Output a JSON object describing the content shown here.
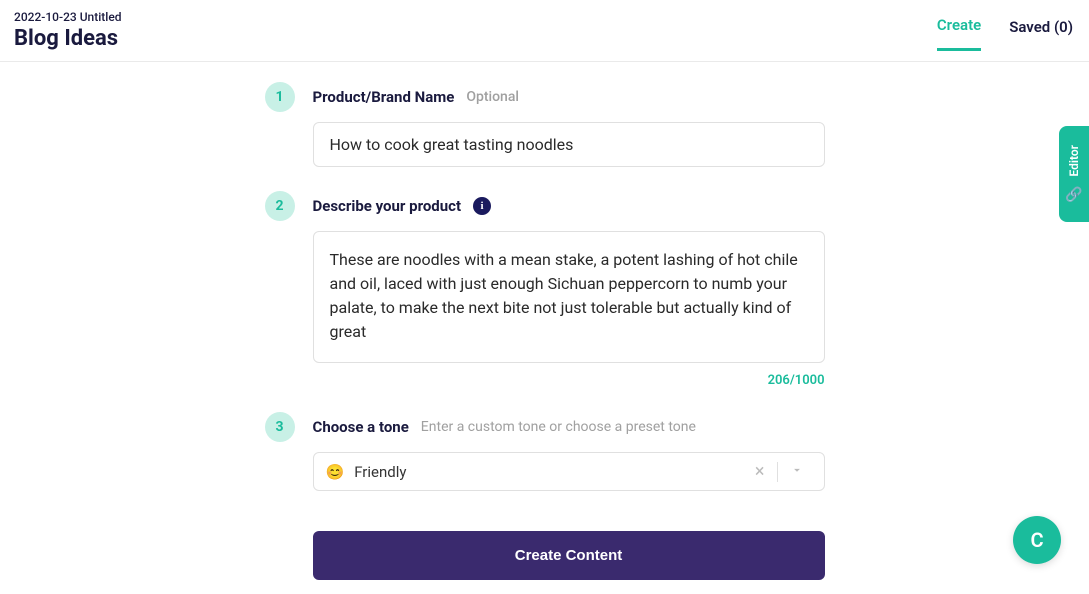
{
  "header": {
    "date": "2022-10-23 Untitled",
    "title": "Blog Ideas",
    "tabs": {
      "create": "Create",
      "saved": "Saved (0)"
    }
  },
  "steps": {
    "s1": {
      "num": "1",
      "label": "Product/Brand Name",
      "optional": "Optional",
      "value": "How to cook great tasting noodles"
    },
    "s2": {
      "num": "2",
      "label": "Describe your product",
      "value": "These are noodles with a mean stake, a potent lashing of hot chile and oil, laced with just enough Sichuan peppercorn to numb your palate, to make the next bite not just tolerable but actually kind of great",
      "counter": "206/1000"
    },
    "s3": {
      "num": "3",
      "label": "Choose a tone",
      "hint": "Enter a custom tone or choose a preset tone",
      "emoji": "😊",
      "value": "Friendly"
    }
  },
  "buttons": {
    "create": "Create Content"
  },
  "side": {
    "editor": "Editor"
  },
  "fab": {
    "label": "C"
  }
}
